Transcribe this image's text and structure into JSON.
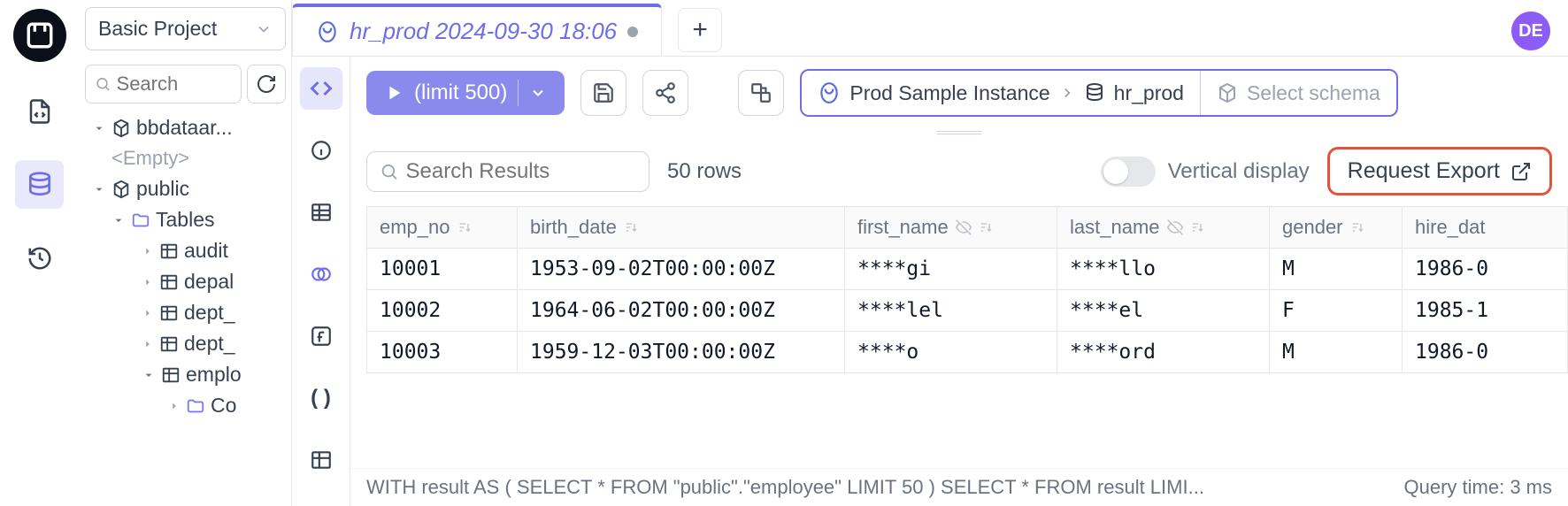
{
  "avatar": "DE",
  "project_selector": {
    "label": "Basic Project"
  },
  "sidebar": {
    "search_placeholder": "Search",
    "tree": {
      "schema1": "bbdataar...",
      "schema1_empty": "<Empty>",
      "schema2": "public",
      "tables_label": "Tables",
      "tables": [
        "audit",
        "depal",
        "dept_",
        "dept_",
        "emplo"
      ],
      "sub_folder": "Co"
    }
  },
  "tab": {
    "title": "hr_prod 2024-09-30 18:06"
  },
  "toolbar": {
    "run_label": "(limit 500)",
    "breadcrumb": {
      "instance": "Prod Sample Instance",
      "database": "hr_prod",
      "schema_placeholder": "Select schema"
    }
  },
  "results": {
    "search_placeholder": "Search Results",
    "row_count": "50 rows",
    "vertical_display_label": "Vertical display",
    "export_label": "Request Export"
  },
  "table": {
    "columns": [
      "emp_no",
      "birth_date",
      "first_name",
      "last_name",
      "gender",
      "hire_dat"
    ],
    "rows": [
      {
        "emp_no": "10001",
        "birth_date": "1953-09-02T00:00:00Z",
        "first_name": "****gi",
        "last_name": "****llo",
        "gender": "M",
        "hire_date": "1986-0"
      },
      {
        "emp_no": "10002",
        "birth_date": "1964-06-02T00:00:00Z",
        "first_name": "****lel",
        "last_name": "****el",
        "gender": "F",
        "hire_date": "1985-1"
      },
      {
        "emp_no": "10003",
        "birth_date": "1959-12-03T00:00:00Z",
        "first_name": "****o",
        "last_name": "****ord",
        "gender": "M",
        "hire_date": "1986-0"
      }
    ]
  },
  "footer": {
    "sql": "WITH result AS ( SELECT * FROM \"public\".\"employee\" LIMIT 50 ) SELECT * FROM result LIMI...",
    "query_time": "Query time: 3 ms"
  }
}
